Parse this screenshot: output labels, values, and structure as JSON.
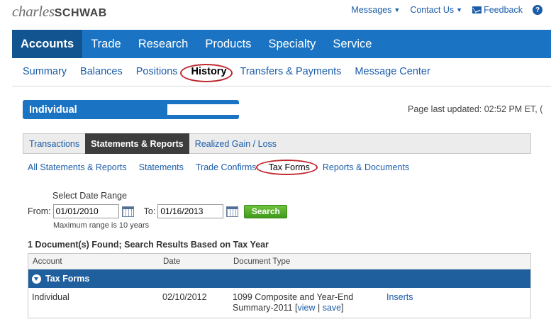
{
  "brand": {
    "part1": "charles",
    "part2": "SCHWAB"
  },
  "util_nav": {
    "messages": "Messages",
    "contact": "Contact Us",
    "feedback": "Feedback",
    "help": "?"
  },
  "main_nav": [
    "Accounts",
    "Trade",
    "Research",
    "Products",
    "Specialty",
    "Service"
  ],
  "sub_nav": [
    "Summary",
    "Balances",
    "Positions",
    "History",
    "Transfers & Payments",
    "Message Center"
  ],
  "account_selector": {
    "label": "Individual"
  },
  "page_updated": "Page last updated: 02:52 PM ET, (",
  "tabs": [
    "Transactions",
    "Statements & Reports",
    "Realized Gain / Loss"
  ],
  "sub_tabs": [
    "All Statements & Reports",
    "Statements",
    "Trade Confirms",
    "Tax Forms",
    "Reports & Documents"
  ],
  "date_range": {
    "title": "Select Date Range",
    "from_label": "From:",
    "from_value": "01/01/2010",
    "to_label": "To:",
    "to_value": "01/16/2013",
    "search_label": "Search",
    "note": "Maximum range is 10 years"
  },
  "results": {
    "summary": "1 Document(s) Found; Search Results Based on Tax Year"
  },
  "table": {
    "headers": {
      "account": "Account",
      "date": "Date",
      "type": "Document Type"
    },
    "group": "Tax Forms",
    "rows": [
      {
        "account": "Individual",
        "date": "02/10/2012",
        "type_line1": "1099 Composite and Year-End",
        "type_line2": "Summary-2011 [",
        "view": "view",
        "sep": " | ",
        "save": "save",
        "close": "]",
        "inserts": "Inserts"
      }
    ]
  },
  "colors": {
    "nav_blue": "#1b74c3",
    "nav_active": "#11548f",
    "link": "#1a5ca8",
    "highlight_oval": "#c0262c",
    "search_green": "#4fa82a"
  }
}
